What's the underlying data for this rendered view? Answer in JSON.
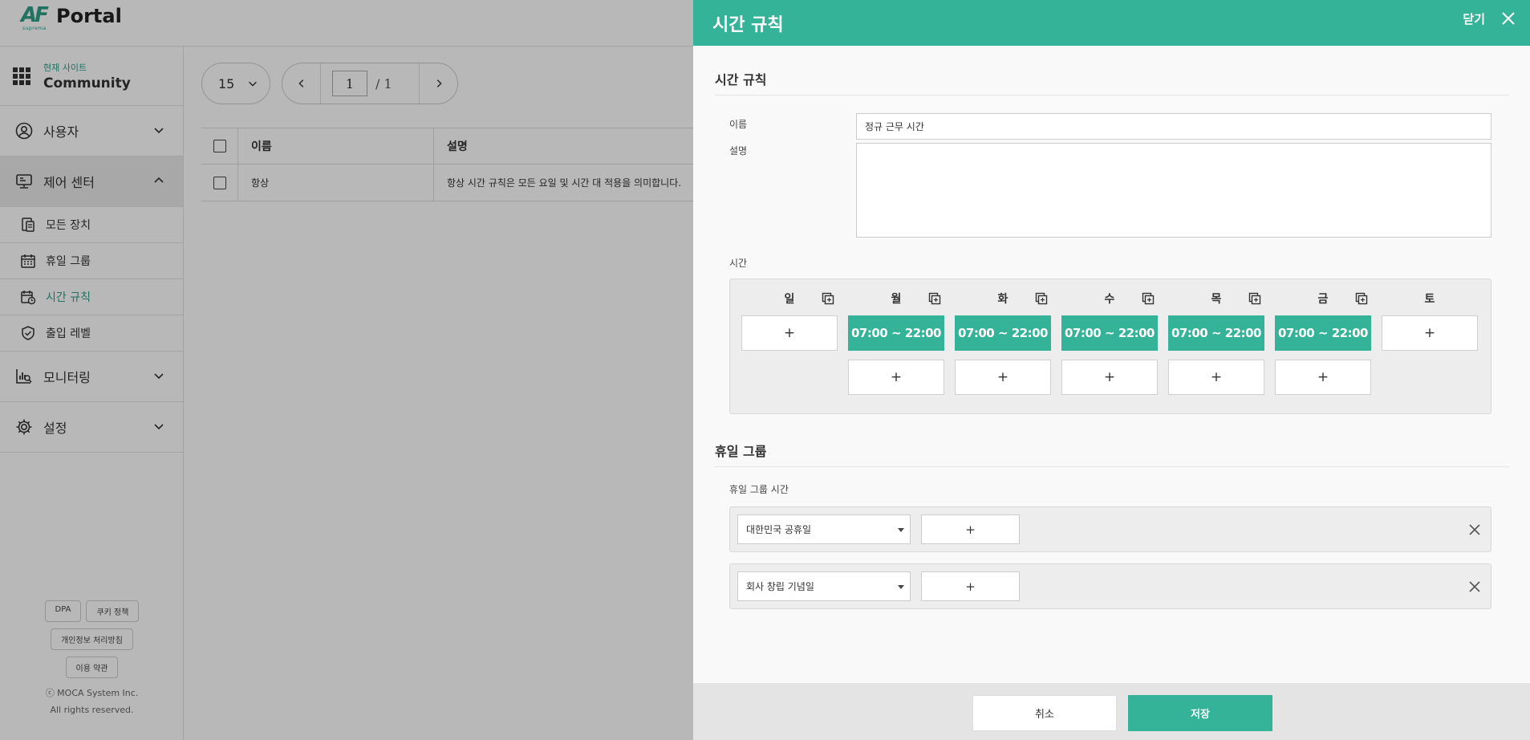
{
  "app": {
    "logo_mark": "AF",
    "logo_sub": "suprema",
    "logo_text": "Portal"
  },
  "sidebar": {
    "site_label": "현재 사이트",
    "site_name": "Community",
    "items": [
      {
        "label": "사용자",
        "icon": "user-icon",
        "expanded": false
      },
      {
        "label": "제어 센터",
        "icon": "control-center-icon",
        "expanded": true,
        "active": true
      },
      {
        "label": "모니터링",
        "icon": "monitoring-icon",
        "expanded": false
      },
      {
        "label": "설정",
        "icon": "gear-icon",
        "expanded": false
      }
    ],
    "sub_items": [
      {
        "label": "모든 장치",
        "icon": "devices-icon"
      },
      {
        "label": "휴일 그룹",
        "icon": "calendar-icon"
      },
      {
        "label": "시간 규칙",
        "icon": "calendar-clock-icon",
        "active": true
      },
      {
        "label": "출입 레벨",
        "icon": "shield-check-icon"
      }
    ],
    "footer": {
      "dpa": "DPA",
      "cookie": "쿠키 정책",
      "privacy": "개인정보 처리방침",
      "terms": "이용 약관",
      "copyright1": "ⓒ MOCA System Inc.",
      "copyright2": "All rights reserved."
    }
  },
  "list": {
    "page_size": "15",
    "page_current": "1",
    "page_total": "/ 1",
    "headers": {
      "name": "이름",
      "description": "설명"
    },
    "rows": [
      {
        "name": "항상",
        "description": "항상 시간 규칙은 모든 요일 및 시간 대 적용을 의미합니다."
      }
    ]
  },
  "panel": {
    "title": "시간 규칙",
    "close_label": "닫기",
    "section_time_rule": "시간 규칙",
    "name_label": "이름",
    "name_value": "정규 근무 시간",
    "description_label": "설명",
    "description_value": "",
    "time_label": "시간",
    "add_symbol": "+",
    "days": [
      {
        "name": "일",
        "slots": [],
        "copy": true
      },
      {
        "name": "월",
        "slots": [
          "07:00 ~ 22:00"
        ],
        "copy": true
      },
      {
        "name": "화",
        "slots": [
          "07:00 ~ 22:00"
        ],
        "copy": true
      },
      {
        "name": "수",
        "slots": [
          "07:00 ~ 22:00"
        ],
        "copy": true
      },
      {
        "name": "목",
        "slots": [
          "07:00 ~ 22:00"
        ],
        "copy": true
      },
      {
        "name": "금",
        "slots": [
          "07:00 ~ 22:00"
        ],
        "copy": true
      },
      {
        "name": "토",
        "slots": [],
        "copy": false
      }
    ],
    "section_holiday": "휴일 그룹",
    "holiday_time_label": "휴일 그룹 시간",
    "holidays": [
      {
        "group": "대한민국 공휴일"
      },
      {
        "group": "회사 창립 기념일"
      }
    ],
    "cancel_label": "취소",
    "save_label": "저장"
  },
  "colors": {
    "accent": "#34b398",
    "brand": "#2f9e86"
  }
}
